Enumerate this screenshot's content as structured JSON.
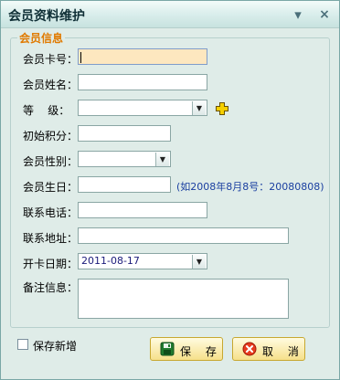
{
  "window": {
    "title": "会员资料维护",
    "minimize_glyph": "▾",
    "close_glyph": "×"
  },
  "group": {
    "legend": "会员信息"
  },
  "form": {
    "card_no_label": "会员卡号：",
    "name_label": "会员姓名：",
    "level_label": "等    级：",
    "initial_points_label": "初始积分：",
    "gender_label": "会员性别：",
    "birthday_label": "会员生日：",
    "birthday_hint": "(如2008年8月8号：20080808)",
    "phone_label": "联系电话：",
    "address_label": "联系地址：",
    "open_date_label": "开卡日期：",
    "open_date_value": "2011-08-17",
    "notes_label": "备注信息："
  },
  "footer": {
    "save_new_label": "保存新增",
    "save_label": "保 存",
    "cancel_label": "取 消"
  },
  "icons": [
    "add-level-icon",
    "save-icon",
    "cancel-icon",
    "dropdown-arrow-icon",
    "minimize-icon",
    "close-icon"
  ],
  "colors": {
    "legend": "#e07a00",
    "hint": "#1a3fa0",
    "active_field": "#fde7bf",
    "button_fill": "#f6e08a"
  }
}
